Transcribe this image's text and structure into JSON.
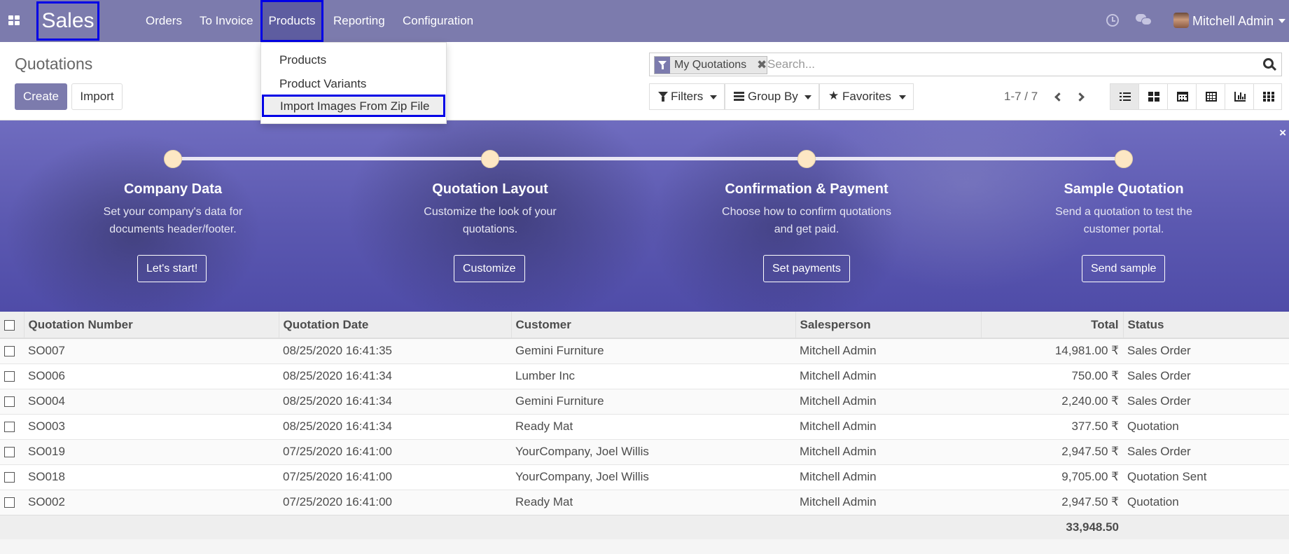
{
  "navbar": {
    "brand": "Sales",
    "menu": [
      {
        "label": "Orders"
      },
      {
        "label": "To Invoice"
      },
      {
        "label": "Products"
      },
      {
        "label": "Reporting"
      },
      {
        "label": "Configuration"
      }
    ],
    "user_name": "Mitchell Admin"
  },
  "products_dropdown": {
    "items": [
      {
        "label": "Products"
      },
      {
        "label": "Product Variants"
      },
      {
        "label": "Import Images From Zip File"
      }
    ]
  },
  "control_panel": {
    "breadcrumb": "Quotations",
    "create_label": "Create",
    "import_label": "Import",
    "search": {
      "facet_label": "My Quotations",
      "facet_remove": "✖",
      "placeholder": "Search..."
    },
    "filters_label": "Filters",
    "group_by_label": "Group By",
    "favorites_label": "Favorites",
    "pager_value": "1-7 / 7",
    "views": [
      "list",
      "kanban",
      "calendar",
      "pivot",
      "graph",
      "activity"
    ]
  },
  "onboarding": {
    "close": "×",
    "steps": [
      {
        "title": "Company Data",
        "desc_line1": "Set your company's data for",
        "desc_line2": "documents header/footer.",
        "button": "Let's start!"
      },
      {
        "title": "Quotation Layout",
        "desc_line1": "Customize the look of your",
        "desc_line2": "quotations.",
        "button": "Customize"
      },
      {
        "title": "Confirmation & Payment",
        "desc_line1": "Choose how to confirm quotations",
        "desc_line2": "and get paid.",
        "button": "Set payments"
      },
      {
        "title": "Sample Quotation",
        "desc_line1": "Send a quotation to test the",
        "desc_line2": "customer portal.",
        "button": "Send sample"
      }
    ]
  },
  "table": {
    "columns": [
      "Quotation Number",
      "Quotation Date",
      "Customer",
      "Salesperson",
      "Total",
      "Status"
    ],
    "rows": [
      {
        "number": "SO007",
        "date": "08/25/2020 16:41:35",
        "customer": "Gemini Furniture",
        "salesperson": "Mitchell Admin",
        "total": "14,981.00 ₹",
        "status": "Sales Order"
      },
      {
        "number": "SO006",
        "date": "08/25/2020 16:41:34",
        "customer": "Lumber Inc",
        "salesperson": "Mitchell Admin",
        "total": "750.00 ₹",
        "status": "Sales Order"
      },
      {
        "number": "SO004",
        "date": "08/25/2020 16:41:34",
        "customer": "Gemini Furniture",
        "salesperson": "Mitchell Admin",
        "total": "2,240.00 ₹",
        "status": "Sales Order"
      },
      {
        "number": "SO003",
        "date": "08/25/2020 16:41:34",
        "customer": "Ready Mat",
        "salesperson": "Mitchell Admin",
        "total": "377.50 ₹",
        "status": "Quotation"
      },
      {
        "number": "SO019",
        "date": "07/25/2020 16:41:00",
        "customer": "YourCompany, Joel Willis",
        "salesperson": "Mitchell Admin",
        "total": "2,947.50 ₹",
        "status": "Sales Order"
      },
      {
        "number": "SO018",
        "date": "07/25/2020 16:41:00",
        "customer": "YourCompany, Joel Willis",
        "salesperson": "Mitchell Admin",
        "total": "9,705.00 ₹",
        "status": "Quotation Sent"
      },
      {
        "number": "SO002",
        "date": "07/25/2020 16:41:00",
        "customer": "Ready Mat",
        "salesperson": "Mitchell Admin",
        "total": "2,947.50 ₹",
        "status": "Quotation"
      }
    ],
    "footer_total": "33,948.50"
  },
  "colors": {
    "brand": "#7c7bad",
    "highlight_outline": "#0000e6",
    "banner": "#5b58b0",
    "step_dot": "#fde7c4"
  }
}
